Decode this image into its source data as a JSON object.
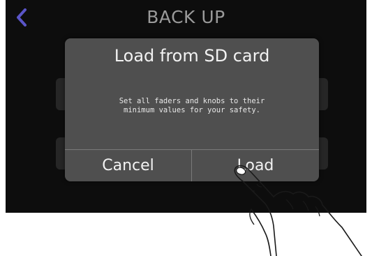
{
  "header": {
    "title": "BACK UP",
    "back_icon": "chevron-left-icon",
    "accent_color": "#5a55c8"
  },
  "dialog": {
    "title": "Load from SD card",
    "message": "Set all faders and knobs to their\nminimum values for your safety.",
    "cancel_label": "Cancel",
    "load_label": "Load"
  },
  "overlay": {
    "hand_icon": "pointing-hand-icon"
  }
}
